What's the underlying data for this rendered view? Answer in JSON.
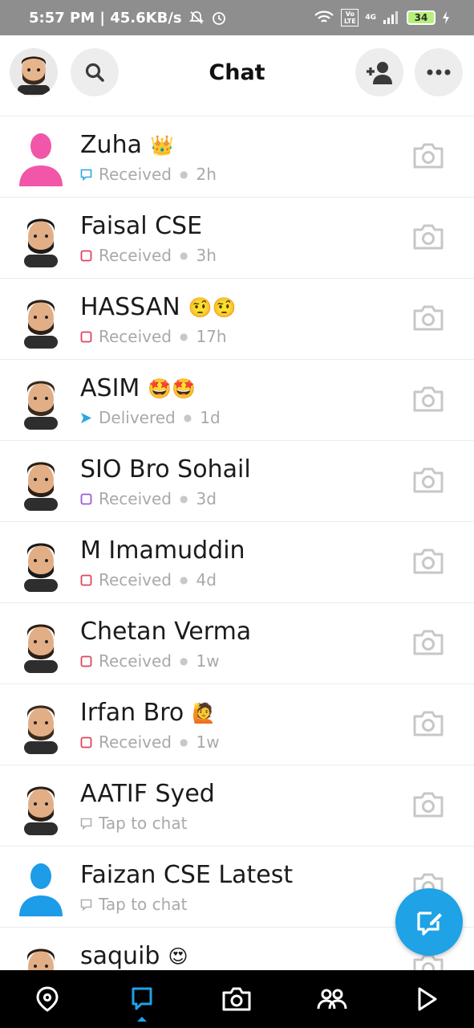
{
  "status_bar": {
    "time_and_speed": "5:57 PM | 45.6KB/s",
    "network_label": "4G",
    "volte_label": "Vo LTE",
    "battery": "34"
  },
  "header": {
    "title": "Chat"
  },
  "chats": [
    {
      "name": "Zuha",
      "emoji": "👑",
      "status": "Received",
      "time": "2h",
      "status_icon": "chat-bubble-outline-icon",
      "status_color": "#2aa7e0",
      "avatar_type": "silhouette",
      "avatar_color": "#f256a8"
    },
    {
      "name": "Faisal CSE",
      "emoji": "",
      "status": "Received",
      "time": "3h",
      "status_icon": "square-outline-icon",
      "status_color": "#e0455b",
      "avatar_type": "bitmoji"
    },
    {
      "name": "HASSAN",
      "emoji": "🤨🤨",
      "status": "Received",
      "time": "17h",
      "status_icon": "square-outline-icon",
      "status_color": "#e0455b",
      "avatar_type": "bitmoji"
    },
    {
      "name": "ASIM",
      "emoji": "🤩🤩",
      "status": "Delivered",
      "time": "1d",
      "status_icon": "arrow-filled-icon",
      "status_color": "#2aa7e0",
      "avatar_type": "bitmoji"
    },
    {
      "name": "SIO Bro Sohail",
      "emoji": "",
      "status": "Received",
      "time": "3d",
      "status_icon": "square-outline-icon",
      "status_color": "#9a5bd0",
      "avatar_type": "bitmoji"
    },
    {
      "name": "M Imamuddin",
      "emoji": "",
      "status": "Received",
      "time": "4d",
      "status_icon": "square-outline-icon",
      "status_color": "#e0455b",
      "avatar_type": "bitmoji"
    },
    {
      "name": "Chetan Verma",
      "emoji": "",
      "status": "Received",
      "time": "1w",
      "status_icon": "square-outline-icon",
      "status_color": "#e0455b",
      "avatar_type": "bitmoji"
    },
    {
      "name": "Irfan Bro",
      "emoji": "🙋",
      "status": "Received",
      "time": "1w",
      "status_icon": "square-outline-icon",
      "status_color": "#e0455b",
      "avatar_type": "bitmoji"
    },
    {
      "name": "AATIF Syed",
      "emoji": "",
      "status": "Tap to chat",
      "time": "",
      "status_icon": "chat-bubble-outline-icon",
      "status_color": "#b0b0b0",
      "avatar_type": "bitmoji"
    },
    {
      "name": "Faizan CSE Latest",
      "emoji": "",
      "status": "Tap to chat",
      "time": "",
      "status_icon": "chat-bubble-outline-icon",
      "status_color": "#b0b0b0",
      "avatar_type": "silhouette",
      "avatar_color": "#1d9ce8"
    },
    {
      "name": "saquib",
      "emoji": "😍",
      "status": "",
      "time": "",
      "status_icon": "",
      "status_color": "#b0b0b0",
      "avatar_type": "bitmoji"
    }
  ],
  "bottom_nav": {
    "items": [
      "map-pin-icon",
      "chat-icon",
      "camera-icon",
      "friends-icon",
      "play-icon"
    ],
    "active": "chat-icon"
  },
  "colors": {
    "accent": "#1fa2e6",
    "received_red": "#e0455b",
    "received_purple": "#9a5bd0"
  }
}
